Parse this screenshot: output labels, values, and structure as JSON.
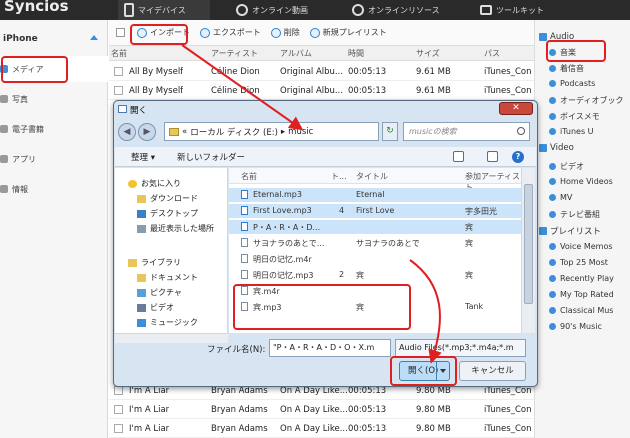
{
  "app": {
    "brand": "Syncios",
    "nav": [
      "マイデバイス",
      "オンライン動画",
      "オンラインリソース",
      "ツールキット"
    ]
  },
  "sidebar": {
    "device": "iPhone",
    "items": [
      {
        "label": "メディア",
        "icon": "music-note-icon"
      },
      {
        "label": "写真",
        "icon": "photo-icon"
      },
      {
        "label": "電子書籍",
        "icon": "book-icon"
      },
      {
        "label": "アプリ",
        "icon": "apps-icon"
      },
      {
        "label": "情報",
        "icon": "info-icon"
      }
    ]
  },
  "toolbar": {
    "import": "インポート",
    "export": "エクスポート",
    "delete": "削除",
    "new_playlist": "新規プレイリスト"
  },
  "table": {
    "headers": [
      "名前",
      "アーティスト",
      "アルバム",
      "時間",
      "サイズ",
      "パス"
    ],
    "top_rows": [
      [
        "All By Myself",
        "Céline Dion",
        "Original Albu...",
        "00:05:13",
        "9.61 MB",
        "iTunes_Con"
      ],
      [
        "All By Myself",
        "Céline Dion",
        "Original Albu...",
        "00:05:13",
        "9.61 MB",
        "iTunes_Con"
      ]
    ],
    "bottom_rows": [
      [
        "I'm A Liar",
        "Bryan Adams",
        "On A Day Like...",
        "00:05:13",
        "9.80 MB",
        "iTunes_Con"
      ],
      [
        "I'm A Liar",
        "Bryan Adams",
        "On A Day Like...",
        "00:05:13",
        "9.80 MB",
        "iTunes_Con"
      ],
      [
        "I'm A Liar",
        "Bryan Adams",
        "On A Day Like...",
        "00:05:13",
        "9.80 MB",
        "iTunes_Con"
      ]
    ]
  },
  "right": {
    "audio_head": "Audio",
    "audio": [
      "音楽",
      "着信音",
      "Podcasts",
      "オーディオブック",
      "ボイスメモ",
      "iTunes U"
    ],
    "video_head": "Video",
    "video": [
      "ビデオ",
      "Home Videos",
      "MV",
      "テレビ番組"
    ],
    "playlist_head": "プレイリスト",
    "playlists": [
      "Voice Memos",
      "Top 25 Most",
      "Recently Play",
      "My Top Rated",
      "Classical Mus",
      "90's Music"
    ]
  },
  "dialog": {
    "title": "開く",
    "path": [
      "«",
      "ローカル ディスク (E:)",
      "▸",
      "music"
    ],
    "search_placeholder": "musicの検索",
    "organize": "整理 ▾",
    "new_folder": "新しいフォルダー",
    "tree": [
      {
        "label": "お気に入り",
        "icon": "star-icon",
        "group": true
      },
      {
        "label": "ダウンロード",
        "icon": "download-folder-icon"
      },
      {
        "label": "デスクトップ",
        "icon": "desktop-icon"
      },
      {
        "label": "最近表示した場所",
        "icon": "recent-places-icon"
      },
      {
        "label": "ライブラリ",
        "icon": "library-icon",
        "group": true
      },
      {
        "label": "ドキュメント",
        "icon": "documents-icon"
      },
      {
        "label": "ピクチャ",
        "icon": "pictures-icon"
      },
      {
        "label": "ビデオ",
        "icon": "videos-icon"
      },
      {
        "label": "ミュージック",
        "icon": "music-library-icon"
      }
    ],
    "file_headers": [
      "名前",
      "ト...",
      "タイトル",
      "参加アーティスト"
    ],
    "files": [
      {
        "name": "Eternal.mp3",
        "track": "",
        "title": "Eternal",
        "artist": "",
        "selected": true
      },
      {
        "name": "First Love.mp3",
        "track": "4",
        "title": "First Love",
        "artist": "宇多田光",
        "selected": true
      },
      {
        "name": "P・A・R・A・D...",
        "track": "",
        "title": "",
        "artist": "宾",
        "selected": true
      },
      {
        "name": "サヨナラのあとで...",
        "track": "",
        "title": "サヨナラのあとで",
        "artist": "宾",
        "selected": false
      },
      {
        "name": "明日の记忆.m4r",
        "track": "",
        "title": "",
        "artist": "",
        "selected": false
      },
      {
        "name": "明日の记忆.mp3",
        "track": "2",
        "title": "宾",
        "artist": "宾",
        "selected": false
      },
      {
        "name": "宾.m4r",
        "track": "",
        "title": "",
        "artist": "",
        "selected": false
      },
      {
        "name": "宾.mp3",
        "track": "",
        "title": "宾",
        "artist": "Tank",
        "selected": false
      }
    ],
    "filename_label": "ファイル名(N):",
    "filename_value": "\"P・A・R・A・D・O・X.m",
    "filetype": "Audio Files(*.mp3;*.m4a;*.m",
    "open": "開く(O)",
    "cancel": "キャンセル"
  }
}
